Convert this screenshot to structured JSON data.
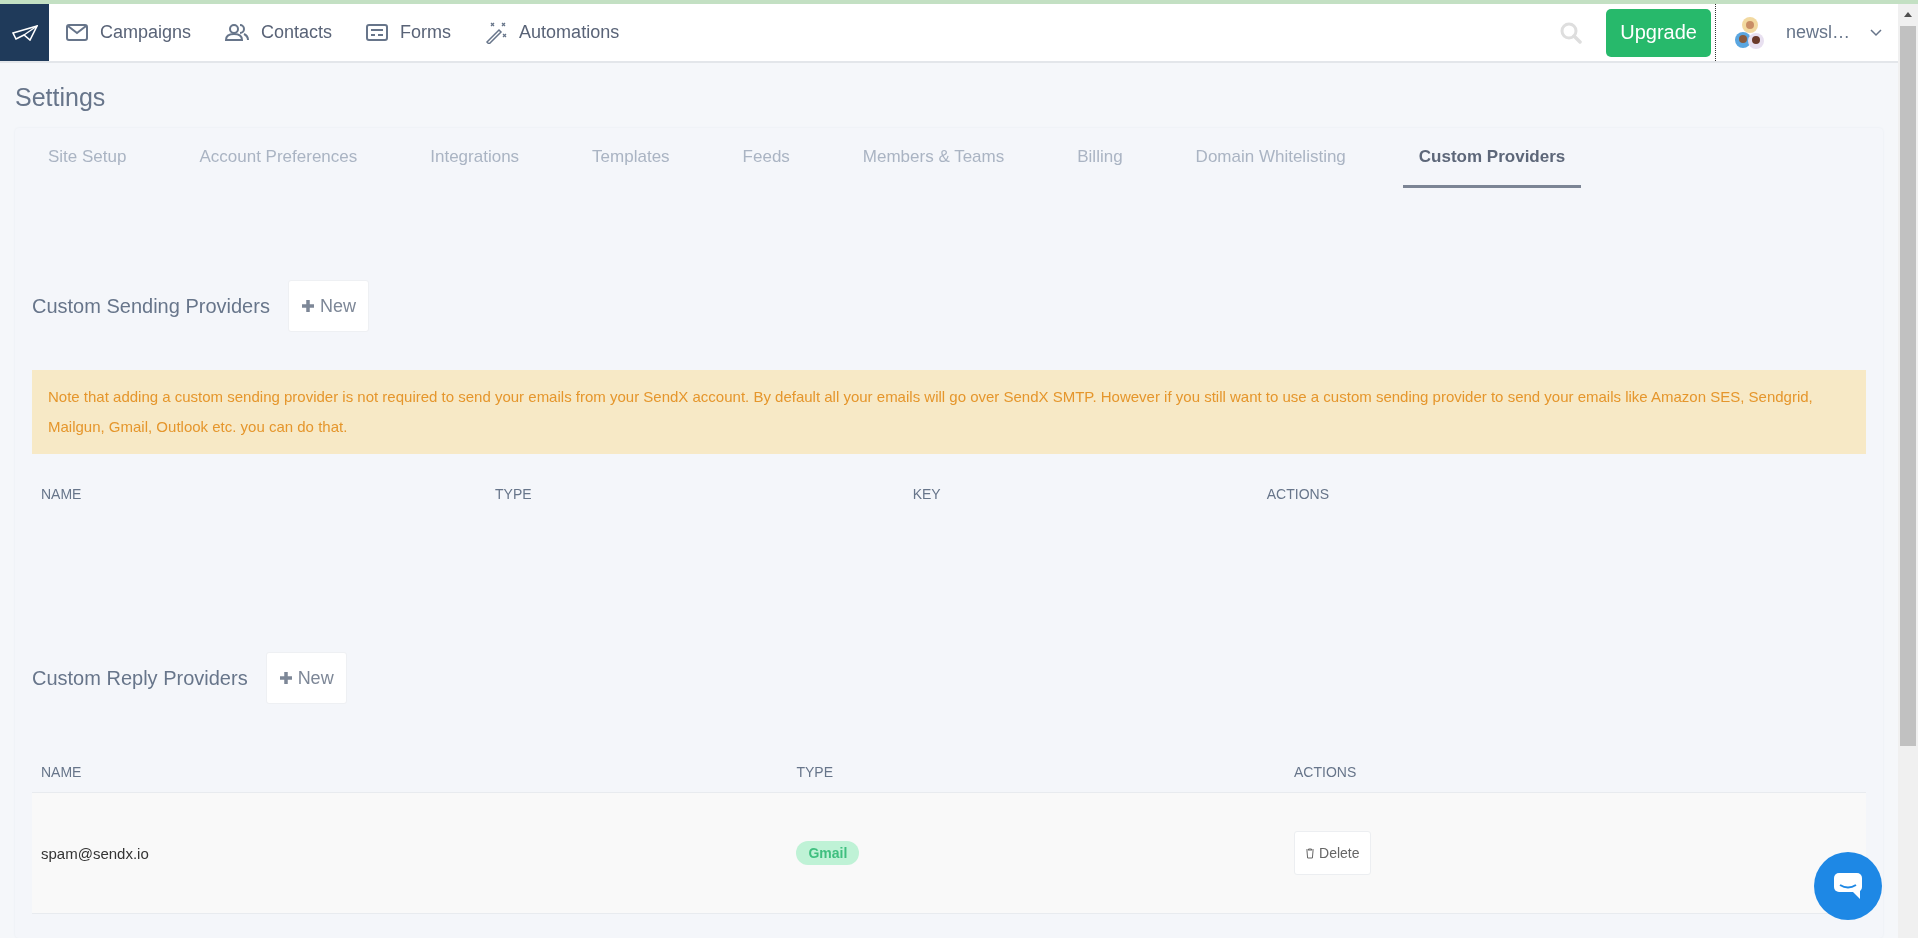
{
  "nav": {
    "items": [
      {
        "label": "Campaigns",
        "kind": "mail"
      },
      {
        "label": "Contacts",
        "kind": "people"
      },
      {
        "label": "Forms",
        "kind": "form"
      },
      {
        "label": "Automations",
        "kind": "wand"
      }
    ],
    "upgrade": "Upgrade",
    "account": "newsl…"
  },
  "page_title": "Settings",
  "tabs": [
    {
      "label": "Site Setup",
      "selected": false
    },
    {
      "label": "Account Preferences",
      "selected": false
    },
    {
      "label": "Integrations",
      "selected": false
    },
    {
      "label": "Templates",
      "selected": false
    },
    {
      "label": "Feeds",
      "selected": false
    },
    {
      "label": "Members & Teams",
      "selected": false
    },
    {
      "label": "Billing",
      "selected": false
    },
    {
      "label": "Domain Whitelisting",
      "selected": false
    },
    {
      "label": "Custom Providers",
      "selected": true
    }
  ],
  "sections": [
    {
      "title": "Custom Sending Providers",
      "new_button": "New",
      "note": "Note that adding a custom sending provider is not required to send your emails from your SendX account. By default all your emails will go over SendX SMTP. However if you still want to use a custom sending provider to send your emails like Amazon SES, Sendgrid, Mailgun, Gmail, Outlook etc. you can do that.",
      "columns": [
        "NAME",
        "TYPE",
        "KEY",
        "ACTIONS"
      ]
    },
    {
      "title": "Custom Reply Providers",
      "new_button": "New",
      "columns": [
        "NAME",
        "TYPE",
        "ACTIONS"
      ],
      "rows": [
        {
          "name": "spam@sendx.io",
          "type": "Gmail",
          "action": "Delete"
        }
      ]
    }
  ]
}
